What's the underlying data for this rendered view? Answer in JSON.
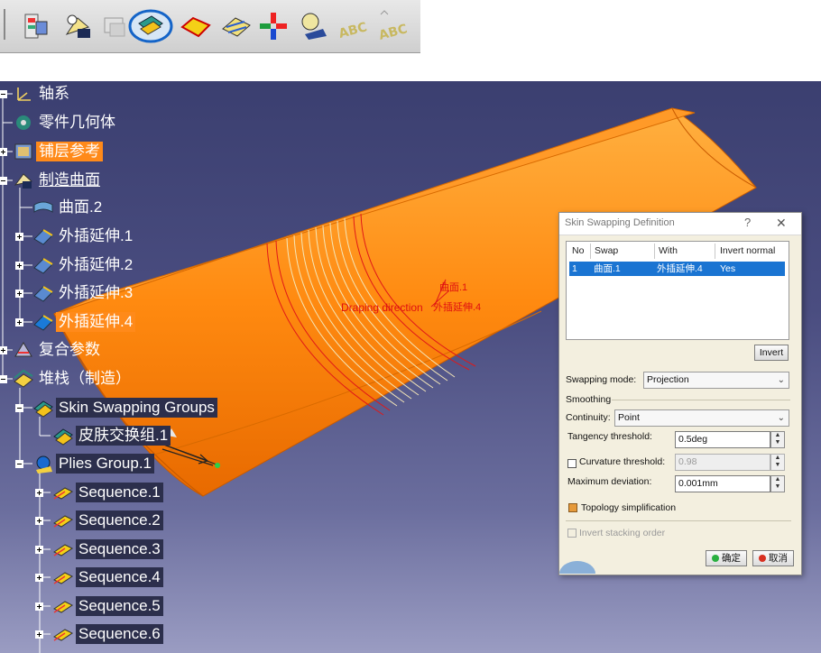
{
  "toolbar": {
    "icons": [
      "ply-table-icon",
      "ply-exploder-icon",
      "core-sampling-icon",
      "skin-swapping-icon",
      "flatten-icon",
      "producibility-icon",
      "rosette-icon",
      "stacking-icon",
      "text-abc-icon",
      "text-abc-2-icon"
    ],
    "selected": "skin-swapping-icon"
  },
  "tree": {
    "items": [
      {
        "label": "轴系",
        "style": "plain"
      },
      {
        "label": "零件几何体",
        "style": "plain"
      },
      {
        "label": "铺层参考",
        "style": "hl"
      },
      {
        "label": "制造曲面",
        "style": "link"
      },
      {
        "label": "曲面.2",
        "style": "plain"
      },
      {
        "label": "外插延伸.1",
        "style": "plain"
      },
      {
        "label": "外插延伸.2",
        "style": "plain"
      },
      {
        "label": "外插延伸.3",
        "style": "plain"
      },
      {
        "label": "外插延伸.4",
        "style": "hl"
      },
      {
        "label": "复合参数",
        "style": "plain"
      },
      {
        "label": "堆栈（制造）",
        "style": "plain"
      },
      {
        "label": "Skin Swapping Groups",
        "style": "dark"
      },
      {
        "label": "皮肤交换组.1",
        "style": "dark"
      },
      {
        "label": "Plies Group.1",
        "style": "dark"
      },
      {
        "label": "Sequence.1",
        "style": "dark"
      },
      {
        "label": "Sequence.2",
        "style": "dark"
      },
      {
        "label": "Sequence.3",
        "style": "dark"
      },
      {
        "label": "Sequence.4",
        "style": "dark"
      },
      {
        "label": "Sequence.5",
        "style": "dark"
      },
      {
        "label": "Sequence.6",
        "style": "dark"
      }
    ]
  },
  "annotations": {
    "surface_label": "曲面.1",
    "extrapol_label": "外插延伸.4",
    "draping_label": "Draping direction"
  },
  "dialog": {
    "title": "Skin Swapping Definition",
    "help": "?",
    "close": "✕",
    "table": {
      "headers": [
        "No",
        "Swap",
        "With",
        "Invert normal"
      ],
      "rows": [
        [
          "1",
          "曲面.1",
          "外插延伸.4",
          "Yes"
        ]
      ]
    },
    "invert_button": "Invert",
    "swapping_mode_label": "Swapping mode:",
    "swapping_mode_value": "Projection",
    "smoothing_label": "Smoothing",
    "continuity_label": "Continuity:",
    "continuity_value": "Point",
    "tangency_label": "Tangency threshold:",
    "tangency_value": "0.5deg",
    "curvature_label": "Curvature threshold:",
    "curvature_value": "0.98",
    "max_dev_label": "Maximum deviation:",
    "max_dev_value": "0.001mm",
    "topology_label": "Topology simplification",
    "invert_stacking_label": "Invert stacking order",
    "ok_label": "确定",
    "cancel_label": "取消"
  },
  "colors": {
    "viewport_bg": "#3f4275",
    "surface": "#ff8c1a",
    "highlight": "#ff8a1a",
    "selection": "#1a74d2"
  }
}
